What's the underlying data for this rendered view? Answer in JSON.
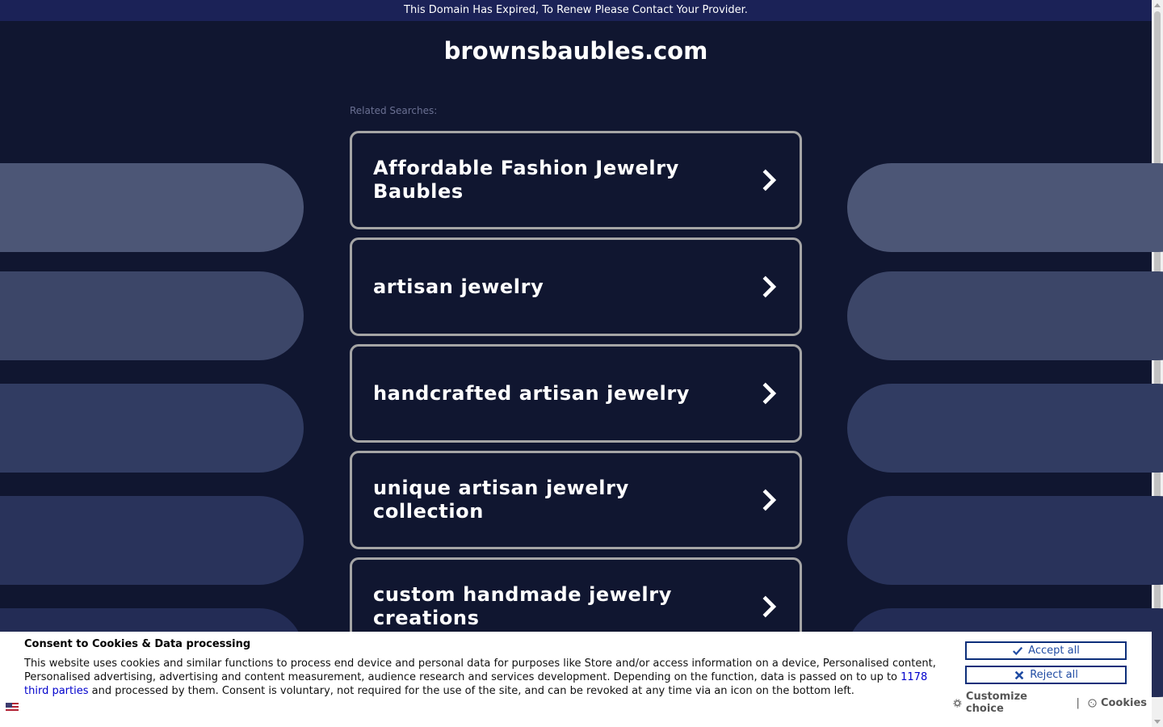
{
  "banner": {
    "text": "This Domain Has Expired, To Renew Please Contact Your Provider."
  },
  "site": {
    "domain": "brownsbaubles.com"
  },
  "related": {
    "label": "Related Searches:",
    "items": [
      "Affordable Fashion Jewelry Baubles",
      "artisan jewelry",
      "handcrafted artisan jewelry",
      "unique artisan jewelry collection",
      "custom handmade jewelry creations"
    ]
  },
  "cookie": {
    "title": "Consent to Cookies & Data processing",
    "text_part1": "This website uses cookies and similar functions to process end device and personal data for purposes like Store and/or access information on a device, Personalised content, Personalised advertising, advertising and content measurement, audience research and services development. Depending on the function, data is passed on to up to ",
    "third_parties_link": "1178 third parties",
    "text_part2": " and processed by them. Consent is voluntary, not required for the use of the site, and can be revoked at any time via an icon on the bottom left.",
    "accept_label": "Accept all",
    "reject_label": "Reject all",
    "customize_label": "Customize choice",
    "separator": "|",
    "cookies_label": "Cookies",
    "language_icon": "us-flag-icon"
  },
  "colors": {
    "background": "#101630",
    "banner": "#1b2257",
    "pill_shades": [
      "#4c5676",
      "#3c4668",
      "#313c62",
      "#29335b",
      "#232c55"
    ],
    "button_border": "#a5a5a5",
    "consent_accent": "#1f4ba3"
  }
}
